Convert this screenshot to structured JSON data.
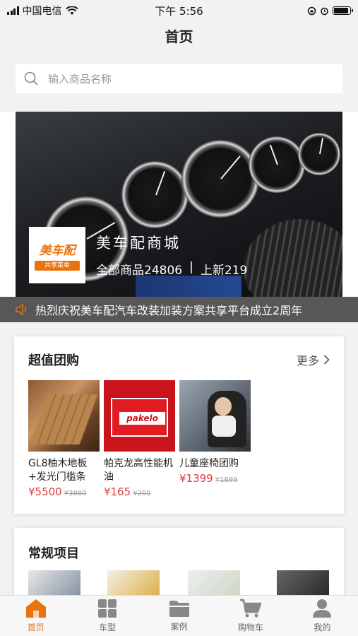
{
  "status": {
    "carrier": "中国电信",
    "time": "下午 5:56",
    "battery_level": 0.9
  },
  "nav": {
    "title": "首页"
  },
  "search": {
    "placeholder": "输入商品名称"
  },
  "banner": {
    "logo_text": "美车配",
    "logo_sub": "共享菜单",
    "store_name": "美车配商城",
    "all_goods": "全部商品24806",
    "separator": "|",
    "new_items": "上新219"
  },
  "notice": {
    "text": "热烈庆祝美车配汽车改装加装方案共享平台成立2周年"
  },
  "group_buy": {
    "title": "超值团购",
    "more": "更多",
    "items": [
      {
        "name": "GL8柚木地板+发光门槛条",
        "price": "¥5500",
        "old_price": "¥3880"
      },
      {
        "name": "帕克龙高性能机油",
        "price": "¥165",
        "old_price": "¥200",
        "brand": "pakelo"
      },
      {
        "name": "儿童座椅团购",
        "price": "¥1399",
        "old_price": "¥1699"
      }
    ]
  },
  "regular": {
    "title": "常规项目"
  },
  "tabbar": {
    "items": [
      {
        "label": "首页",
        "icon": "home-icon",
        "active": true
      },
      {
        "label": "车型",
        "icon": "grid-icon",
        "active": false
      },
      {
        "label": "案例",
        "icon": "folder-icon",
        "active": false
      },
      {
        "label": "购物车",
        "icon": "cart-icon",
        "active": false
      },
      {
        "label": "我的",
        "icon": "user-icon",
        "active": false
      }
    ]
  },
  "colors": {
    "accent": "#e8730e",
    "price": "#e33b3b",
    "notice_bg": "#575757"
  }
}
